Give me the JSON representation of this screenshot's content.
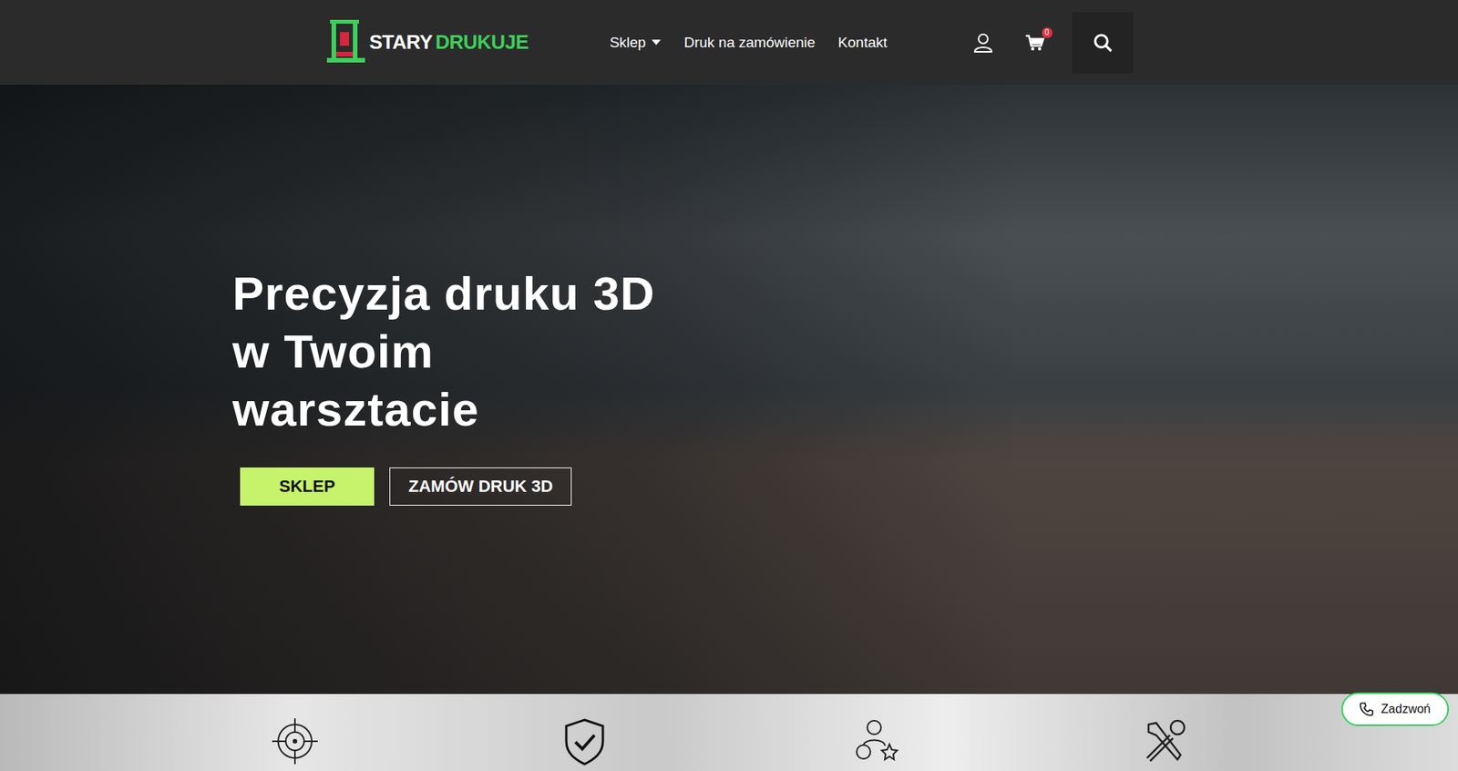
{
  "logo": {
    "first": "STARY",
    "second": "DRUKUJE"
  },
  "nav": [
    {
      "label": "Sklep",
      "has_dropdown": true
    },
    {
      "label": "Druk na zamówienie",
      "has_dropdown": false
    },
    {
      "label": "Kontakt",
      "has_dropdown": false
    }
  ],
  "cart": {
    "count": "0"
  },
  "hero": {
    "title_lines": [
      "Precyzja druku 3D",
      "w Twoim",
      "warsztacie"
    ],
    "buttons": [
      {
        "label": "SKLEP",
        "kind": "primary"
      },
      {
        "label": "ZAMÓW DRUK 3D",
        "kind": "outline"
      }
    ]
  },
  "call_button": {
    "label": "Zadzwoń"
  }
}
